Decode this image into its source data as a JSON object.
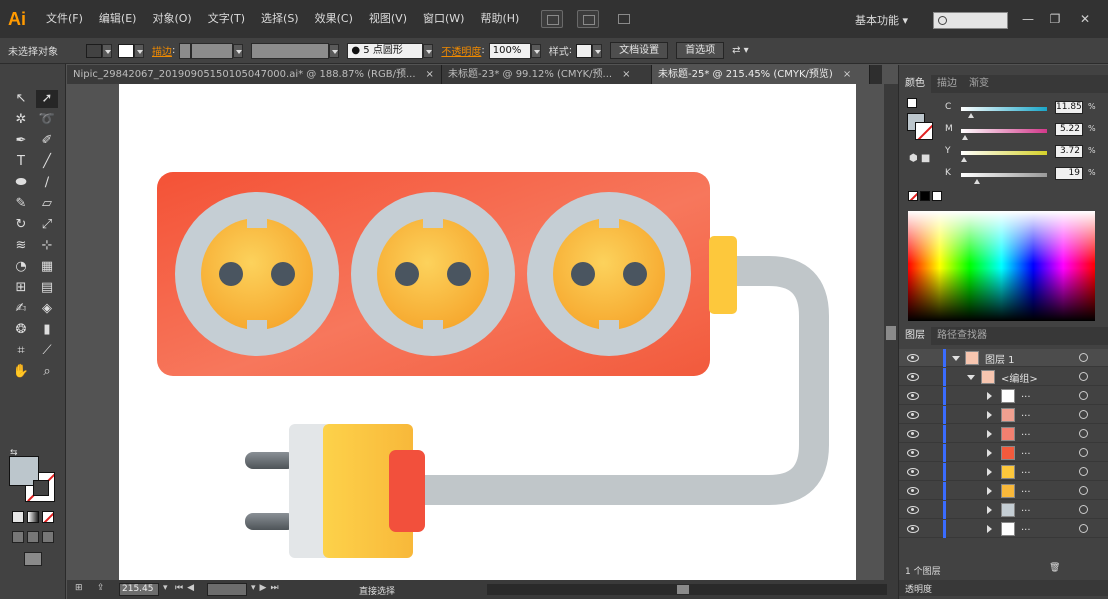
{
  "app": {
    "logo": "Ai",
    "menu": [
      "文件(F)",
      "编辑(E)",
      "对象(O)",
      "文字(T)",
      "选择(S)",
      "效果(C)",
      "视图(V)",
      "窗口(W)",
      "帮助(H)"
    ],
    "workspace": "基本功能",
    "window_controls": [
      "—",
      "❐",
      "✕"
    ]
  },
  "control_bar": {
    "selection": "未选择对象",
    "stroke_label": "描边",
    "brush_label": "● 5 点圆形",
    "opacity_label": "不透明度",
    "opacity_value": "100%",
    "style_label": "样式",
    "doc_settings": "文档设置",
    "preferences": "首选项"
  },
  "tabs": [
    {
      "title": "Nipic_29842067_20190905150105047000.ai* @ 188.87% (RGB/预...",
      "active": false
    },
    {
      "title": "未标题-23* @ 99.12% (CMYK/预...",
      "active": false
    },
    {
      "title": "未标题-25* @ 215.45% (CMYK/预览)",
      "active": true
    }
  ],
  "status_bar": {
    "zoom": "215.45",
    "tool_name": "直接选择"
  },
  "color_panel": {
    "tabs": [
      "颜色",
      "描边",
      "渐变"
    ],
    "channels": [
      {
        "label": "C",
        "value": "11.85",
        "fraction": 0.12,
        "color": "#1aa6c8"
      },
      {
        "label": "M",
        "value": "5.22",
        "fraction": 0.05,
        "color": "#d2388a"
      },
      {
        "label": "Y",
        "value": "3.72",
        "fraction": 0.04,
        "color": "#d6d22a"
      },
      {
        "label": "K",
        "value": "19",
        "fraction": 0.19,
        "color": "#9a9a9a"
      }
    ],
    "unit": "%"
  },
  "layers_panel": {
    "tabs": [
      "图层",
      "路径查找器"
    ],
    "layer_name": "图层 1",
    "group_name": "<编组>",
    "sublayer_label": "...",
    "footer_count": "1 个图层",
    "bottom_tab": "透明度"
  },
  "artwork": {
    "strip_color": "#f25a3c",
    "socket_ring": "#c5ced4",
    "socket_face": "#f8b83a",
    "hole_color": "#4a5560",
    "cable_color": "#c0c6c9",
    "plug_yellow": "#fdc83c",
    "plug_white": "#e3e6e8",
    "plug_red": "#f2503c",
    "prong_color": "#6a6f74"
  }
}
